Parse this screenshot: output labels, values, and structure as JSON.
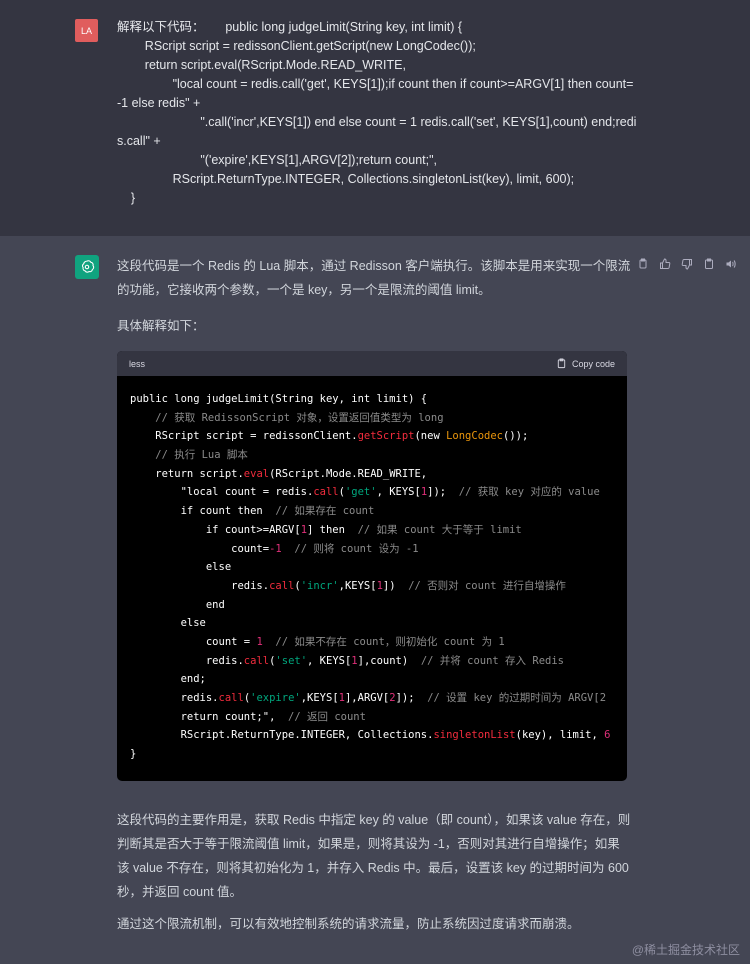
{
  "user": {
    "avatar_initials": "LA",
    "message": "解释以下代码：      public long judgeLimit(String key, int limit) {\n        RScript script = redissonClient.getScript(new LongCodec());\n        return script.eval(RScript.Mode.READ_WRITE,\n                \"local count = redis.call('get', KEYS[1]);if count then if count>=ARGV[1] then count=-1 else redis\" +\n                        \".call('incr',KEYS[1]) end else count = 1 redis.call('set', KEYS[1],count) end;redis.call\" +\n                        \"('expire',KEYS[1],ARGV[2]);return count;\",\n                RScript.ReturnType.INTEGER, Collections.singletonList(key), limit, 600);\n    }"
  },
  "assistant": {
    "icons": [
      "copy-icon",
      "thumbs-up-icon",
      "thumbs-down-icon",
      "clipboard-icon",
      "speaker-icon"
    ],
    "intro": "这段代码是一个 Redis 的 Lua 脚本，通过 Redisson 客户端执行。该脚本是用来实现一个限流的功能，它接收两个参数，一个是 key，另一个是限流的阈值 limit。",
    "detail_heading": "具体解释如下：",
    "code_block": {
      "language": "less",
      "copy_label": "Copy code",
      "lines": [
        "public long judgeLimit(String key, int limit) {",
        "    // 获取 RedissonScript 对象，设置返回值类型为 long",
        "    RScript script = redissonClient.getScript(new LongCodec());",
        "    // 执行 Lua 脚本",
        "    return script.eval(RScript.Mode.READ_WRITE,",
        "        \"local count = redis.call('get', KEYS[1]);  // 获取 key 对应的 value",
        "        if count then  // 如果存在 count",
        "            if count>=ARGV[1] then  // 如果 count 大于等于 limit",
        "                count=-1  // 则将 count 设为 -1",
        "            else",
        "                redis.call('incr',KEYS[1])  // 否则对 count 进行自增操作",
        "            end",
        "        else",
        "            count = 1  // 如果不存在 count，则初始化 count 为 1",
        "            redis.call('set', KEYS[1],count)  // 并将 count 存入 Redis",
        "        end;",
        "        redis.call('expire',KEYS[1],ARGV[2]);  // 设置 key 的过期时间为 ARGV[2",
        "        return count;\",  // 返回 count",
        "        RScript.ReturnType.INTEGER, Collections.singletonList(key), limit, 6",
        "}"
      ]
    },
    "summary": "这段代码的主要作用是，获取 Redis 中指定 key 的 value（即 count），如果该 value 存在，则判断其是否大于等于限流阈值 limit，如果是，则将其设为 -1，否则对其进行自增操作；如果该 value 不存在，则将其初始化为 1，并存入 Redis 中。最后，设置该 key 的过期时间为 600 秒，并返回 count 值。",
    "conclusion": "通过这个限流机制，可以有效地控制系统的请求流量，防止系统因过度请求而崩溃。"
  },
  "watermark": "@稀土掘金技术社区",
  "colors": {
    "user_bg": "#343541",
    "assistant_bg": "#444654",
    "gpt_avatar": "#10a37f",
    "user_avatar": "#e05d5d"
  }
}
